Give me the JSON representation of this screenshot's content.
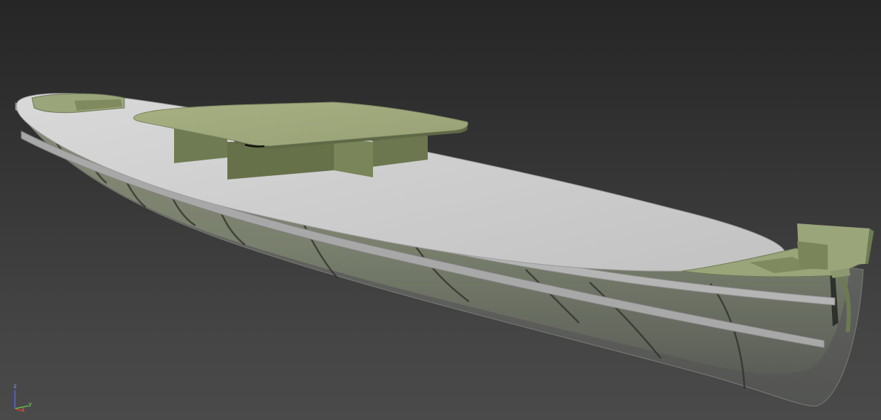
{
  "viewport": {
    "kind": "3D perspective viewport",
    "subject": "ship-hull-model",
    "colors": {
      "background_top": "#262626",
      "background_bottom": "#4a4a4a",
      "deck": "#c9c9c9",
      "structure_green": "#9aa57a",
      "hull_translucent": "#8d9288"
    }
  },
  "axis_gizmo": {
    "z_label": "z",
    "y_label": "y",
    "x_label": "x",
    "colors": {
      "z": "#5b6cff",
      "y": "#5fd04a",
      "x": "#e0402a"
    }
  }
}
